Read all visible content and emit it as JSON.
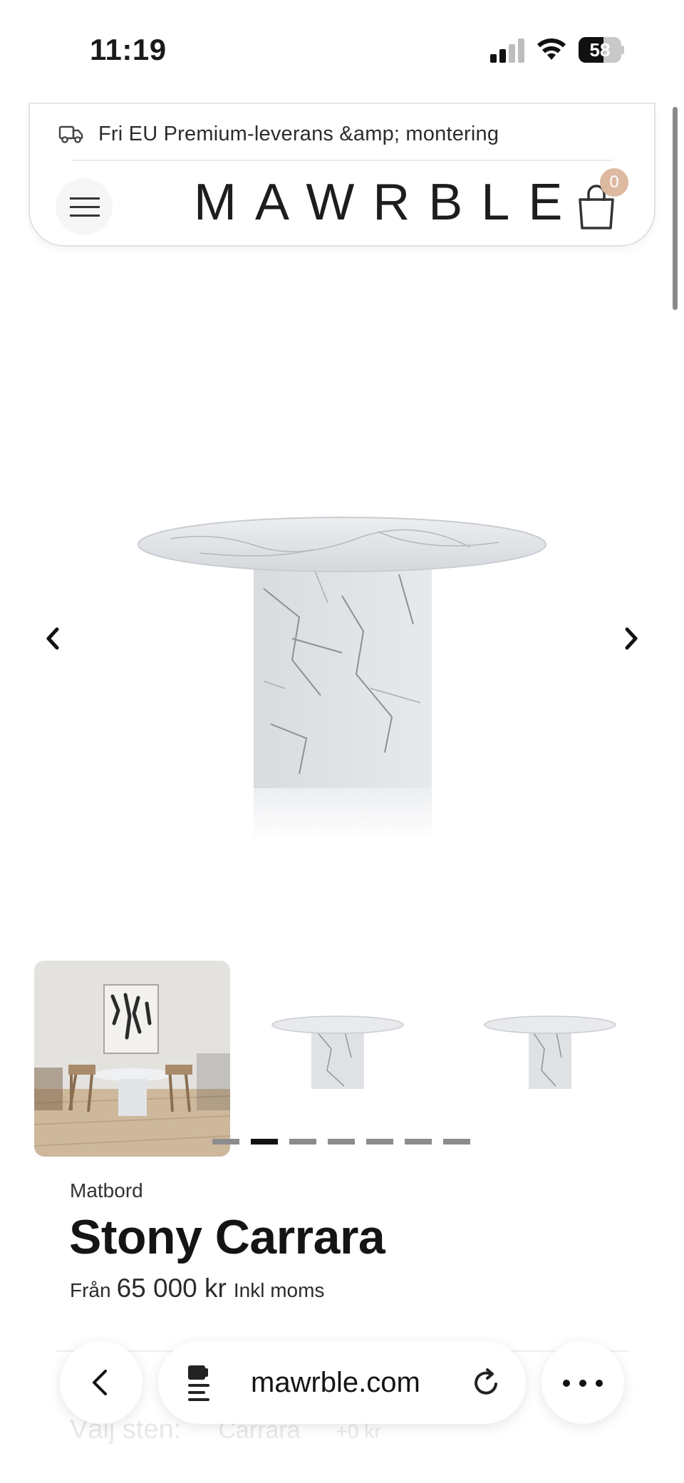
{
  "status_bar": {
    "time": "11:19",
    "battery": "58",
    "battery_level": 0.58,
    "signal_bars_active": 2,
    "signal_bars_total": 4
  },
  "header": {
    "promo_text": "Fri EU Premium-leverans &amp; montering",
    "promo_icon": "truck-icon",
    "logo": "MAWRBLE",
    "cart_count": "0",
    "cart_icon": "shopping-bag-icon",
    "menu_icon": "hamburger-menu-icon"
  },
  "gallery": {
    "prev_icon": "chevron-left-icon",
    "next_icon": "chevron-right-icon",
    "thumbnails": [
      {
        "kind": "room-photo"
      },
      {
        "kind": "table-photo"
      },
      {
        "kind": "table-photo"
      }
    ],
    "dots_total": 7,
    "dots_active_index": 1
  },
  "product": {
    "category": "Matbord",
    "title": "Stony Carrara",
    "price_prefix": "Från",
    "price_value": "65 000 kr",
    "price_suffix": "Inkl moms"
  },
  "option": {
    "label": "Välj sten:",
    "value": "Carrara",
    "price": "+0 kr"
  },
  "browser_bar": {
    "url": "mawrble.com",
    "back_icon": "chevron-left-icon",
    "reader_icon": "page-settings-icon",
    "reload_icon": "reload-icon",
    "more_icon": "ellipsis-icon"
  },
  "colors": {
    "badge": "#dcb9a0",
    "text": "#1a1a1a",
    "marble": "#e9eaec"
  }
}
